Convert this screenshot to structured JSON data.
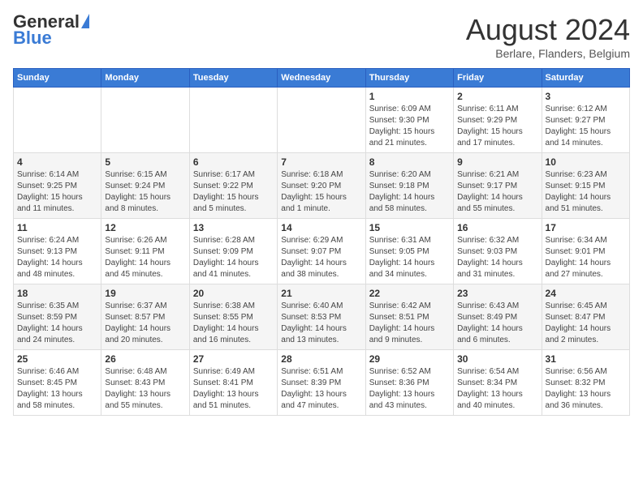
{
  "header": {
    "logo_general": "General",
    "logo_blue": "Blue",
    "month_title": "August 2024",
    "location": "Berlare, Flanders, Belgium"
  },
  "weekdays": [
    "Sunday",
    "Monday",
    "Tuesday",
    "Wednesday",
    "Thursday",
    "Friday",
    "Saturday"
  ],
  "weeks": [
    [
      {
        "day": "",
        "info": ""
      },
      {
        "day": "",
        "info": ""
      },
      {
        "day": "",
        "info": ""
      },
      {
        "day": "",
        "info": ""
      },
      {
        "day": "1",
        "info": "Sunrise: 6:09 AM\nSunset: 9:30 PM\nDaylight: 15 hours\nand 21 minutes."
      },
      {
        "day": "2",
        "info": "Sunrise: 6:11 AM\nSunset: 9:29 PM\nDaylight: 15 hours\nand 17 minutes."
      },
      {
        "day": "3",
        "info": "Sunrise: 6:12 AM\nSunset: 9:27 PM\nDaylight: 15 hours\nand 14 minutes."
      }
    ],
    [
      {
        "day": "4",
        "info": "Sunrise: 6:14 AM\nSunset: 9:25 PM\nDaylight: 15 hours\nand 11 minutes."
      },
      {
        "day": "5",
        "info": "Sunrise: 6:15 AM\nSunset: 9:24 PM\nDaylight: 15 hours\nand 8 minutes."
      },
      {
        "day": "6",
        "info": "Sunrise: 6:17 AM\nSunset: 9:22 PM\nDaylight: 15 hours\nand 5 minutes."
      },
      {
        "day": "7",
        "info": "Sunrise: 6:18 AM\nSunset: 9:20 PM\nDaylight: 15 hours\nand 1 minute."
      },
      {
        "day": "8",
        "info": "Sunrise: 6:20 AM\nSunset: 9:18 PM\nDaylight: 14 hours\nand 58 minutes."
      },
      {
        "day": "9",
        "info": "Sunrise: 6:21 AM\nSunset: 9:17 PM\nDaylight: 14 hours\nand 55 minutes."
      },
      {
        "day": "10",
        "info": "Sunrise: 6:23 AM\nSunset: 9:15 PM\nDaylight: 14 hours\nand 51 minutes."
      }
    ],
    [
      {
        "day": "11",
        "info": "Sunrise: 6:24 AM\nSunset: 9:13 PM\nDaylight: 14 hours\nand 48 minutes."
      },
      {
        "day": "12",
        "info": "Sunrise: 6:26 AM\nSunset: 9:11 PM\nDaylight: 14 hours\nand 45 minutes."
      },
      {
        "day": "13",
        "info": "Sunrise: 6:28 AM\nSunset: 9:09 PM\nDaylight: 14 hours\nand 41 minutes."
      },
      {
        "day": "14",
        "info": "Sunrise: 6:29 AM\nSunset: 9:07 PM\nDaylight: 14 hours\nand 38 minutes."
      },
      {
        "day": "15",
        "info": "Sunrise: 6:31 AM\nSunset: 9:05 PM\nDaylight: 14 hours\nand 34 minutes."
      },
      {
        "day": "16",
        "info": "Sunrise: 6:32 AM\nSunset: 9:03 PM\nDaylight: 14 hours\nand 31 minutes."
      },
      {
        "day": "17",
        "info": "Sunrise: 6:34 AM\nSunset: 9:01 PM\nDaylight: 14 hours\nand 27 minutes."
      }
    ],
    [
      {
        "day": "18",
        "info": "Sunrise: 6:35 AM\nSunset: 8:59 PM\nDaylight: 14 hours\nand 24 minutes."
      },
      {
        "day": "19",
        "info": "Sunrise: 6:37 AM\nSunset: 8:57 PM\nDaylight: 14 hours\nand 20 minutes."
      },
      {
        "day": "20",
        "info": "Sunrise: 6:38 AM\nSunset: 8:55 PM\nDaylight: 14 hours\nand 16 minutes."
      },
      {
        "day": "21",
        "info": "Sunrise: 6:40 AM\nSunset: 8:53 PM\nDaylight: 14 hours\nand 13 minutes."
      },
      {
        "day": "22",
        "info": "Sunrise: 6:42 AM\nSunset: 8:51 PM\nDaylight: 14 hours\nand 9 minutes."
      },
      {
        "day": "23",
        "info": "Sunrise: 6:43 AM\nSunset: 8:49 PM\nDaylight: 14 hours\nand 6 minutes."
      },
      {
        "day": "24",
        "info": "Sunrise: 6:45 AM\nSunset: 8:47 PM\nDaylight: 14 hours\nand 2 minutes."
      }
    ],
    [
      {
        "day": "25",
        "info": "Sunrise: 6:46 AM\nSunset: 8:45 PM\nDaylight: 13 hours\nand 58 minutes."
      },
      {
        "day": "26",
        "info": "Sunrise: 6:48 AM\nSunset: 8:43 PM\nDaylight: 13 hours\nand 55 minutes."
      },
      {
        "day": "27",
        "info": "Sunrise: 6:49 AM\nSunset: 8:41 PM\nDaylight: 13 hours\nand 51 minutes."
      },
      {
        "day": "28",
        "info": "Sunrise: 6:51 AM\nSunset: 8:39 PM\nDaylight: 13 hours\nand 47 minutes."
      },
      {
        "day": "29",
        "info": "Sunrise: 6:52 AM\nSunset: 8:36 PM\nDaylight: 13 hours\nand 43 minutes."
      },
      {
        "day": "30",
        "info": "Sunrise: 6:54 AM\nSunset: 8:34 PM\nDaylight: 13 hours\nand 40 minutes."
      },
      {
        "day": "31",
        "info": "Sunrise: 6:56 AM\nSunset: 8:32 PM\nDaylight: 13 hours\nand 36 minutes."
      }
    ]
  ]
}
